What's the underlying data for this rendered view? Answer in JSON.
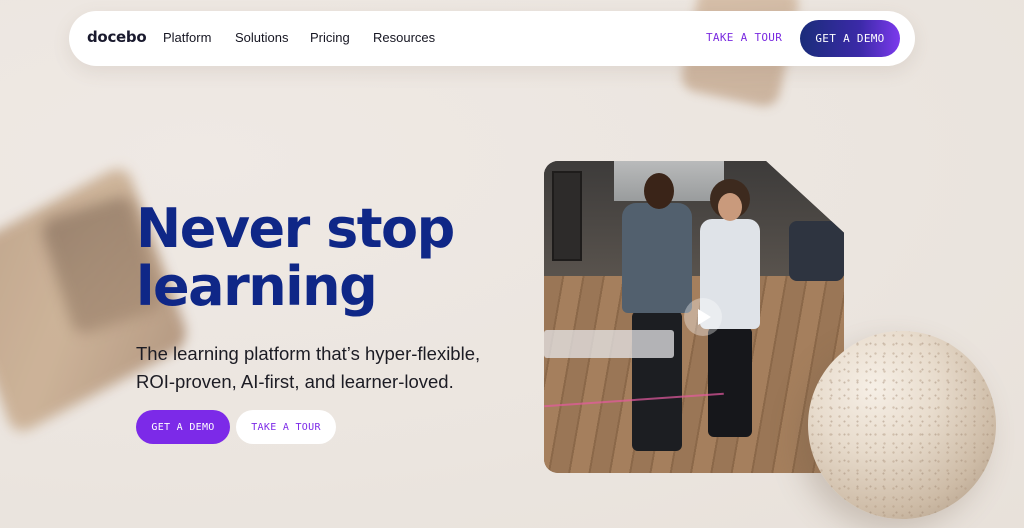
{
  "nav": {
    "logo": "docebo",
    "links": [
      "Platform",
      "Solutions",
      "Pricing",
      "Resources"
    ],
    "tour_label": "TAKE A TOUR",
    "demo_label": "GET A DEMO"
  },
  "hero": {
    "title": "Never stop learning",
    "subtitle": "The learning platform that’s hyper-flexible, ROI-proven, AI-first, and learner-loved.",
    "cta_primary": "GET A DEMO",
    "cta_secondary": "TAKE A TOUR"
  },
  "video": {
    "play_icon": "play-icon"
  },
  "colors": {
    "brand_navy": "#0f2787",
    "brand_purple": "#7c2ae8",
    "background": "#ece6e0"
  }
}
